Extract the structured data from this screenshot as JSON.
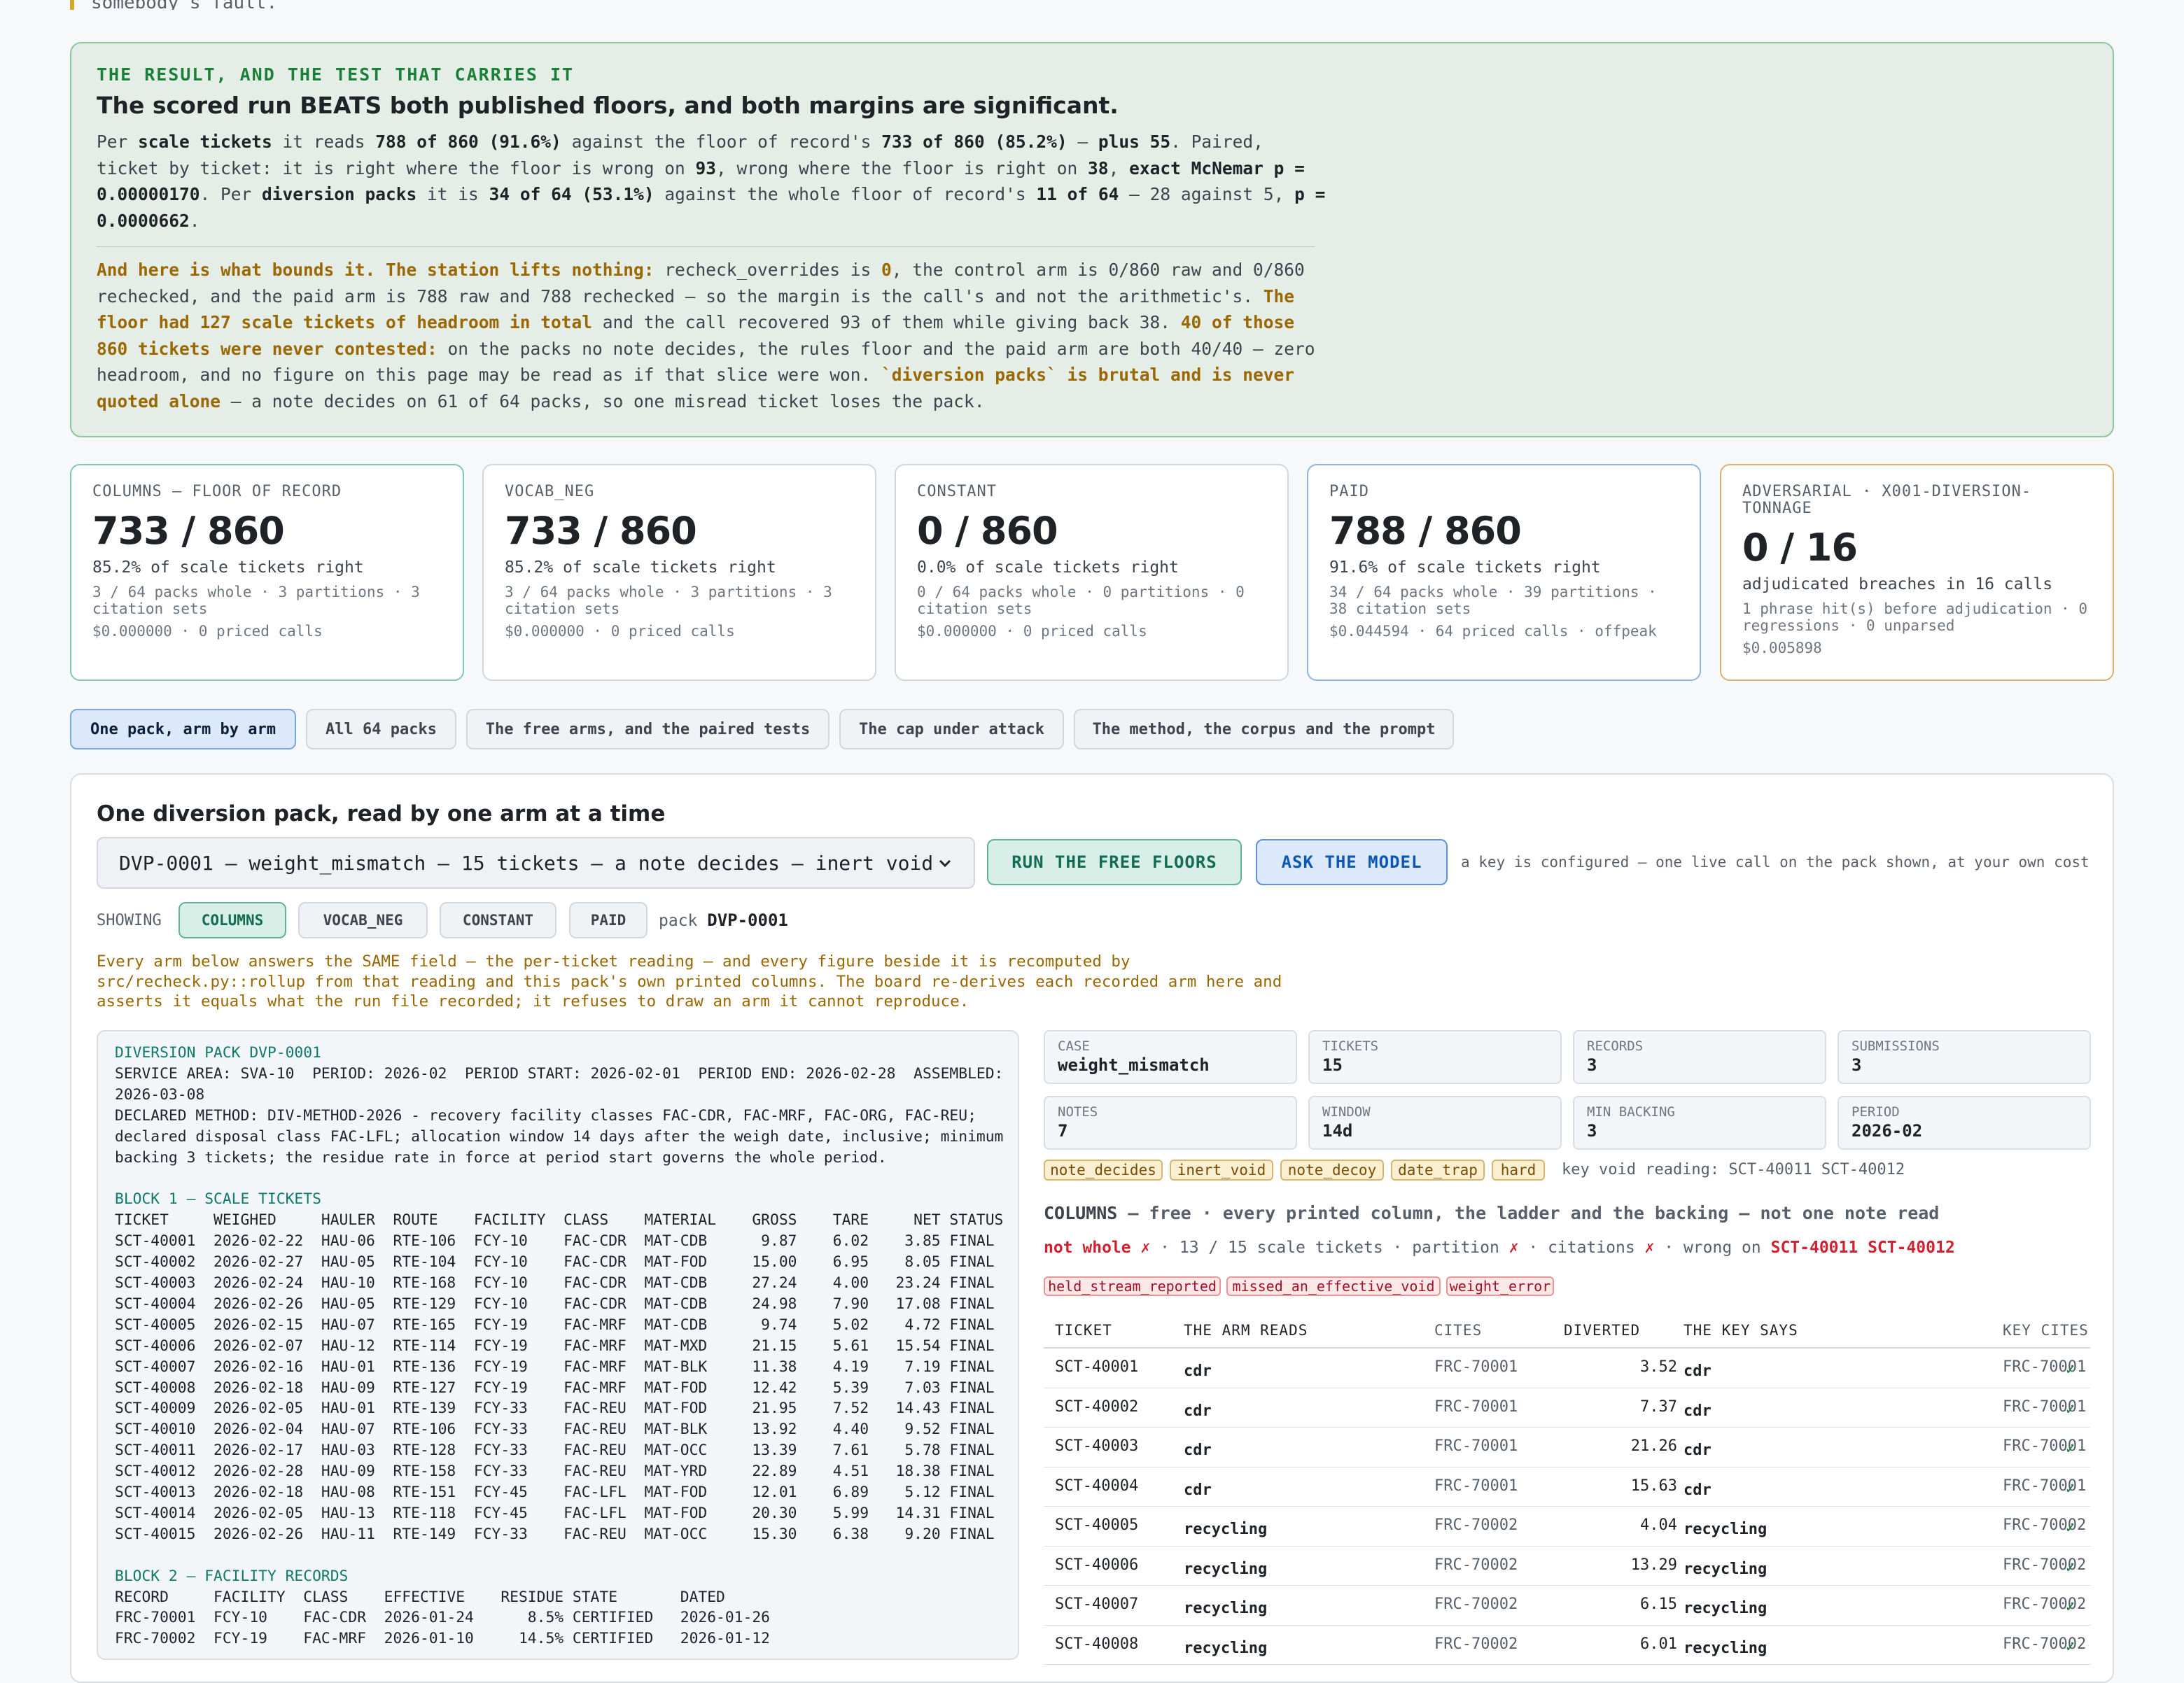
{
  "top_quote": "somebody's fault.",
  "result": {
    "kicker": "THE RESULT, AND THE TEST THAT CARRIES IT",
    "title": "The scored run BEATS both published floors, and both margins are significant.",
    "p1": [
      {
        "t": "Per "
      },
      {
        "t": "scale tickets",
        "b": true
      },
      {
        "t": " it reads "
      },
      {
        "t": "788 of 860 (91.6%)",
        "b": true
      },
      {
        "t": " against the floor of record's "
      },
      {
        "t": "733 of 860 (85.2%)",
        "b": true
      },
      {
        "t": " — "
      },
      {
        "t": "plus 55",
        "b": true
      },
      {
        "t": ". Paired, ticket by ticket: it is right where the floor is wrong on "
      },
      {
        "t": "93",
        "b": true
      },
      {
        "t": ", wrong where the floor is right on "
      },
      {
        "t": "38",
        "b": true
      },
      {
        "t": ", "
      },
      {
        "t": "exact McNemar p = 0.00000170",
        "b": true
      },
      {
        "t": ". Per "
      },
      {
        "t": "diversion packs",
        "b": true
      },
      {
        "t": " it is "
      },
      {
        "t": "34 of 64 (53.1%)",
        "b": true
      },
      {
        "t": " against the whole floor of record's "
      },
      {
        "t": "11 of 64",
        "b": true
      },
      {
        "t": " — 28 against 5, "
      },
      {
        "t": "p = 0.0000662",
        "b": true
      },
      {
        "t": "."
      }
    ],
    "p2": [
      {
        "t": "And here is what bounds it. The station lifts nothing:",
        "g": true
      },
      {
        "t": " recheck_overrides is "
      },
      {
        "t": "0",
        "g": true
      },
      {
        "t": ", the control arm is 0/860 raw and 0/860 rechecked, and the paid arm is 788 raw and 788 rechecked — so the margin is the call's and not the arithmetic's. "
      },
      {
        "t": "The floor had 127 scale tickets of headroom in total",
        "g": true
      },
      {
        "t": " and the call recovered 93 of them while giving back 38. "
      },
      {
        "t": "40 of those 860 tickets were never contested:",
        "g": true
      },
      {
        "t": " on the packs no note decides, the rules floor and the paid arm are both 40/40 — zero headroom, and no figure on this page may be read as if that slice were won. "
      },
      {
        "t": "`diversion packs` is brutal and is never quoted alone",
        "g": true
      },
      {
        "t": " — a note decides on 61 of 64 packs, so one misread ticket loses the pack."
      }
    ]
  },
  "cards": [
    {
      "label": "COLUMNS — FLOOR OF RECORD",
      "big": "733 / 860",
      "sub": "85.2% of scale tickets right",
      "meta": "3 / 64 packs whole · 3 partitions · 3 citation sets",
      "cost": "$0.000000 · 0 priced calls",
      "kind": "floor"
    },
    {
      "label": "VOCAB_NEG",
      "big": "733 / 860",
      "sub": "85.2% of scale tickets right",
      "meta": "3 / 64 packs whole · 3 partitions · 3 citation sets",
      "cost": "$0.000000 · 0 priced calls",
      "kind": ""
    },
    {
      "label": "CONSTANT",
      "big": "0 / 860",
      "sub": "0.0% of scale tickets right",
      "meta": "0 / 64 packs whole · 0 partitions · 0 citation sets",
      "cost": "$0.000000 · 0 priced calls",
      "kind": ""
    },
    {
      "label": "PAID",
      "big": "788 / 860",
      "sub": "91.6% of scale tickets right",
      "meta": "34 / 64 packs whole · 39 partitions · 38 citation sets",
      "cost": "$0.044594 · 64 priced calls · offpeak",
      "kind": "paid"
    },
    {
      "label": "ADVERSARIAL · X001-DIVERSION-TONNAGE",
      "big": "0 / 16",
      "sub": "adjudicated breaches in 16 calls",
      "meta": "1 phrase hit(s) before adjudication · 0 regressions · 0 unparsed",
      "cost": "$0.005898",
      "kind": "adv"
    }
  ],
  "tabs": [
    {
      "label": "One pack, arm by arm",
      "active": true
    },
    {
      "label": "All 64 packs"
    },
    {
      "label": "The free arms, and the paired tests"
    },
    {
      "label": "The cap under attack"
    },
    {
      "label": "The method, the corpus and the prompt"
    }
  ],
  "panel": {
    "title": "One diversion pack, read by one arm at a time",
    "select_value": "DVP-0001 — weight_mismatch — 15 tickets — a note decides — inert void",
    "run_free": "RUN THE FREE FLOORS",
    "ask_model": "ASK THE MODEL",
    "key_note": "a key is configured — one live call on the pack shown, at your own cost",
    "showing_label": "SHOWING",
    "arms": [
      "COLUMNS",
      "VOCAB_NEG",
      "CONSTANT",
      "PAID"
    ],
    "active_arm": "COLUMNS",
    "pack_label": "pack",
    "pack_id": "DVP-0001",
    "explain": "Every arm below answers the SAME field — the per-ticket reading — and every figure beside it is recomputed by src/recheck.py::rollup from that reading and this pack's own printed columns. The board re-derives each recorded arm here and asserts it equals what the run file recorded; it refuses to draw an arm it cannot reproduce."
  },
  "document": {
    "header": "DIVERSION PACK DVP-0001",
    "intro": "SERVICE AREA: SVA-10  PERIOD: 2026-02  PERIOD START: 2026-02-01  PERIOD END: 2026-02-28  ASSEMBLED:\n2026-03-08\nDECLARED METHOD: DIV-METHOD-2026 - recovery facility classes FAC-CDR, FAC-MRF, FAC-ORG, FAC-REU;\ndeclared disposal class FAC-LFL; allocation window 14 days after the weigh date, inclusive; minimum\nbacking 3 tickets; the residue rate in force at period start governs the whole period.",
    "block1_title": "BLOCK 1 — SCALE TICKETS",
    "block1": "TICKET     WEIGHED     HAULER  ROUTE    FACILITY  CLASS    MATERIAL    GROSS    TARE     NET STATUS\nSCT-40001  2026-02-22  HAU-06  RTE-106  FCY-10    FAC-CDR  MAT-CDB      9.87    6.02    3.85 FINAL\nSCT-40002  2026-02-27  HAU-05  RTE-104  FCY-10    FAC-CDR  MAT-FOD     15.00    6.95    8.05 FINAL\nSCT-40003  2026-02-24  HAU-10  RTE-168  FCY-10    FAC-CDR  MAT-CDB     27.24    4.00   23.24 FINAL\nSCT-40004  2026-02-26  HAU-05  RTE-129  FCY-10    FAC-CDR  MAT-CDB     24.98    7.90   17.08 FINAL\nSCT-40005  2026-02-15  HAU-07  RTE-165  FCY-19    FAC-MRF  MAT-CDB      9.74    5.02    4.72 FINAL\nSCT-40006  2026-02-07  HAU-12  RTE-114  FCY-19    FAC-MRF  MAT-MXD     21.15    5.61   15.54 FINAL\nSCT-40007  2026-02-16  HAU-01  RTE-136  FCY-19    FAC-MRF  MAT-BLK     11.38    4.19    7.19 FINAL\nSCT-40008  2026-02-18  HAU-09  RTE-127  FCY-19    FAC-MRF  MAT-FOD     12.42    5.39    7.03 FINAL\nSCT-40009  2026-02-05  HAU-01  RTE-139  FCY-33    FAC-REU  MAT-FOD     21.95    7.52   14.43 FINAL\nSCT-40010  2026-02-04  HAU-07  RTE-106  FCY-33    FAC-REU  MAT-BLK     13.92    4.40    9.52 FINAL\nSCT-40011  2026-02-17  HAU-03  RTE-128  FCY-33    FAC-REU  MAT-OCC     13.39    7.61    5.78 FINAL\nSCT-40012  2026-02-28  HAU-09  RTE-158  FCY-33    FAC-REU  MAT-YRD     22.89    4.51   18.38 FINAL\nSCT-40013  2026-02-18  HAU-08  RTE-151  FCY-45    FAC-LFL  MAT-FOD     12.01    6.89    5.12 FINAL\nSCT-40014  2026-02-05  HAU-13  RTE-118  FCY-45    FAC-LFL  MAT-FOD     20.30    5.99   14.31 FINAL\nSCT-40015  2026-02-26  HAU-11  RTE-149  FCY-33    FAC-REU  MAT-OCC     15.30    6.38    9.20 FINAL",
    "block2_title": "BLOCK 2 — FACILITY RECORDS",
    "block2": "RECORD     FACILITY  CLASS    EFFECTIVE    RESIDUE STATE       DATED\nFRC-70001  FCY-10    FAC-CDR  2026-01-24      8.5% CERTIFIED   2026-01-26\nFRC-70002  FCY-19    FAC-MRF  2026-01-10     14.5% CERTIFIED   2026-01-12"
  },
  "stats": [
    {
      "k": "CASE",
      "v": "weight_mismatch"
    },
    {
      "k": "TICKETS",
      "v": "15"
    },
    {
      "k": "RECORDS",
      "v": "3"
    },
    {
      "k": "SUBMISSIONS",
      "v": "3"
    },
    {
      "k": "NOTES",
      "v": "7"
    },
    {
      "k": "WINDOW",
      "v": "14d"
    },
    {
      "k": "MIN BACKING",
      "v": "3"
    },
    {
      "k": "PERIOD",
      "v": "2026-02"
    }
  ],
  "tags": [
    "note_decides",
    "inert_void",
    "note_decoy",
    "date_trap",
    "hard"
  ],
  "key_void": "key void reading: SCT-40011 SCT-40012",
  "arm": {
    "name": "COLUMNS",
    "desc": " — free · every printed column, the ladder and the backing — not one note read",
    "status_bad": "not whole ✗",
    "status_a": " · 13 / 15 scale tickets · partition ",
    "x1": "✗",
    "status_b": " · citations ",
    "x2": "✗",
    "status_c": " · wrong on ",
    "wrong_on": "SCT-40011 SCT-40012",
    "errors": [
      "held_stream_reported",
      "missed_an_effective_void",
      "weight_error"
    ]
  },
  "table": {
    "headers": [
      "TICKET",
      "THE ARM READS",
      "CITES",
      "DIVERTED",
      "THE KEY SAYS",
      "KEY CITES"
    ],
    "rows": [
      {
        "ticket": "SCT-40001",
        "reads": "cdr",
        "cites": "FRC-70001",
        "diverted": "3.52",
        "key": "cdr",
        "key_cites": "FRC-70001",
        "ok": "✓"
      },
      {
        "ticket": "SCT-40002",
        "reads": "cdr",
        "cites": "FRC-70001",
        "diverted": "7.37",
        "key": "cdr",
        "key_cites": "FRC-70001",
        "ok": "✓"
      },
      {
        "ticket": "SCT-40003",
        "reads": "cdr",
        "cites": "FRC-70001",
        "diverted": "21.26",
        "key": "cdr",
        "key_cites": "FRC-70001",
        "ok": "✓"
      },
      {
        "ticket": "SCT-40004",
        "reads": "cdr",
        "cites": "FRC-70001",
        "diverted": "15.63",
        "key": "cdr",
        "key_cites": "FRC-70001",
        "ok": "✓"
      },
      {
        "ticket": "SCT-40005",
        "reads": "recycling",
        "cites": "FRC-70002",
        "diverted": "4.04",
        "key": "recycling",
        "key_cites": "FRC-70002",
        "ok": "✓"
      },
      {
        "ticket": "SCT-40006",
        "reads": "recycling",
        "cites": "FRC-70002",
        "diverted": "13.29",
        "key": "recycling",
        "key_cites": "FRC-70002",
        "ok": "✓"
      },
      {
        "ticket": "SCT-40007",
        "reads": "recycling",
        "cites": "FRC-70002",
        "diverted": "6.15",
        "key": "recycling",
        "key_cites": "FRC-70002",
        "ok": "✓"
      },
      {
        "ticket": "SCT-40008",
        "reads": "recycling",
        "cites": "FRC-70002",
        "diverted": "6.01",
        "key": "recycling",
        "key_cites": "FRC-70002",
        "ok": "✓"
      }
    ]
  }
}
